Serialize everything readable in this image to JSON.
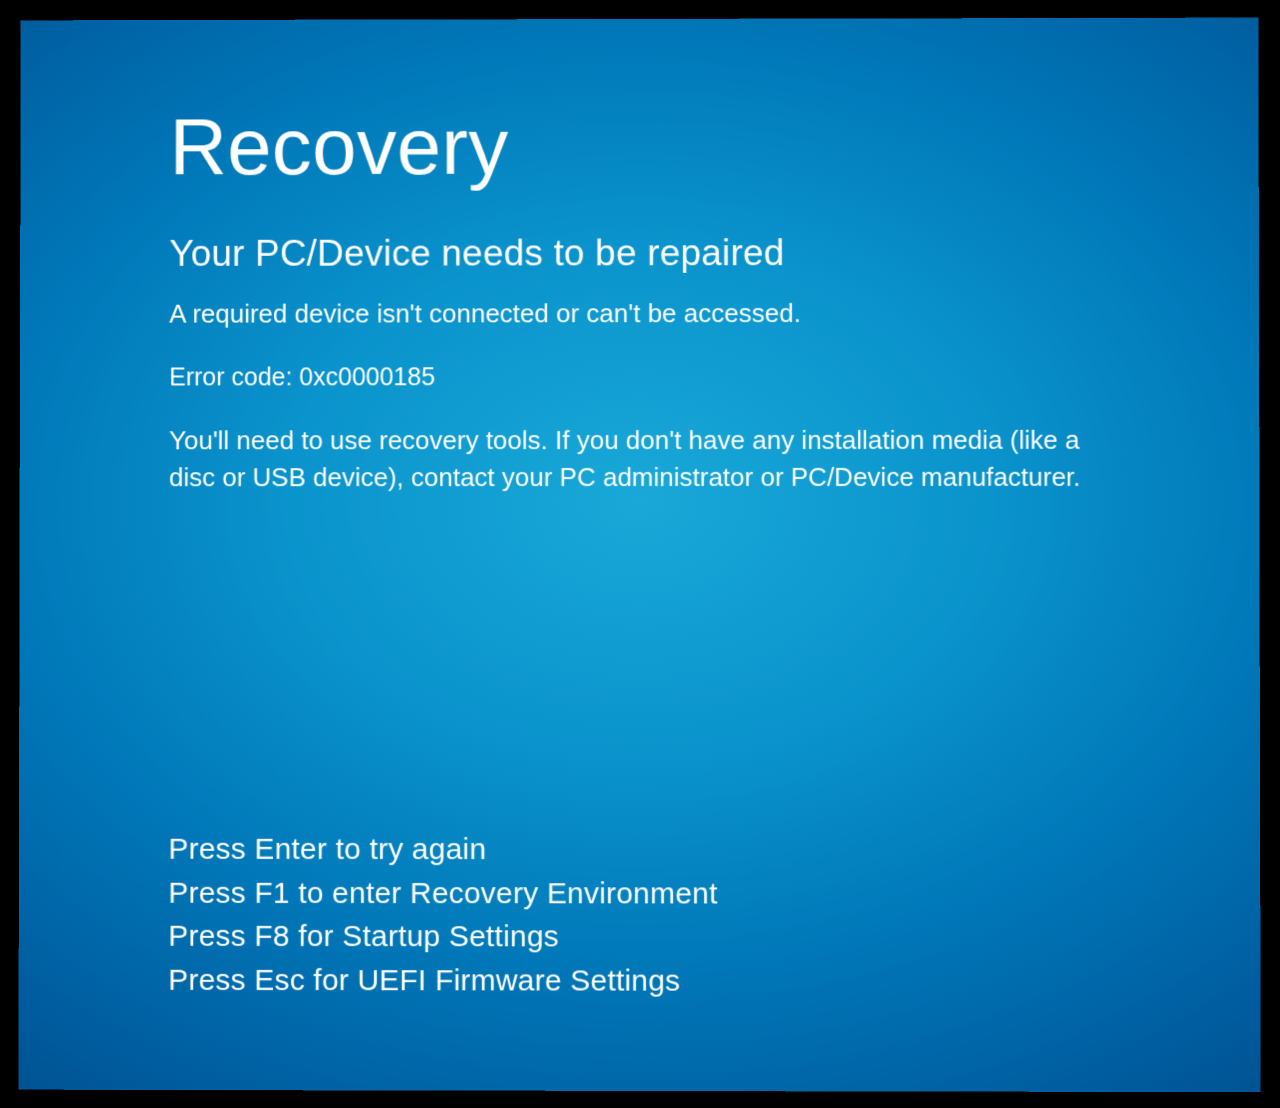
{
  "recovery": {
    "title": "Recovery",
    "subtitle": "Your PC/Device needs to be repaired",
    "description": "A required device isn't connected or can't be accessed.",
    "error_code": "Error code: 0xc0000185",
    "instruction": "You'll need to use recovery tools. If you don't have any installation media (like a disc or USB device), contact your PC administrator or PC/Device manufacturer.",
    "options": [
      "Press Enter to try again",
      "Press F1 to enter Recovery Environment",
      "Press F8 for Startup Settings",
      "Press Esc for UEFI Firmware Settings"
    ]
  },
  "colors": {
    "background_center": "#19a8d8",
    "background_edge": "#004680",
    "text": "#ffffff",
    "border": "#000000"
  }
}
